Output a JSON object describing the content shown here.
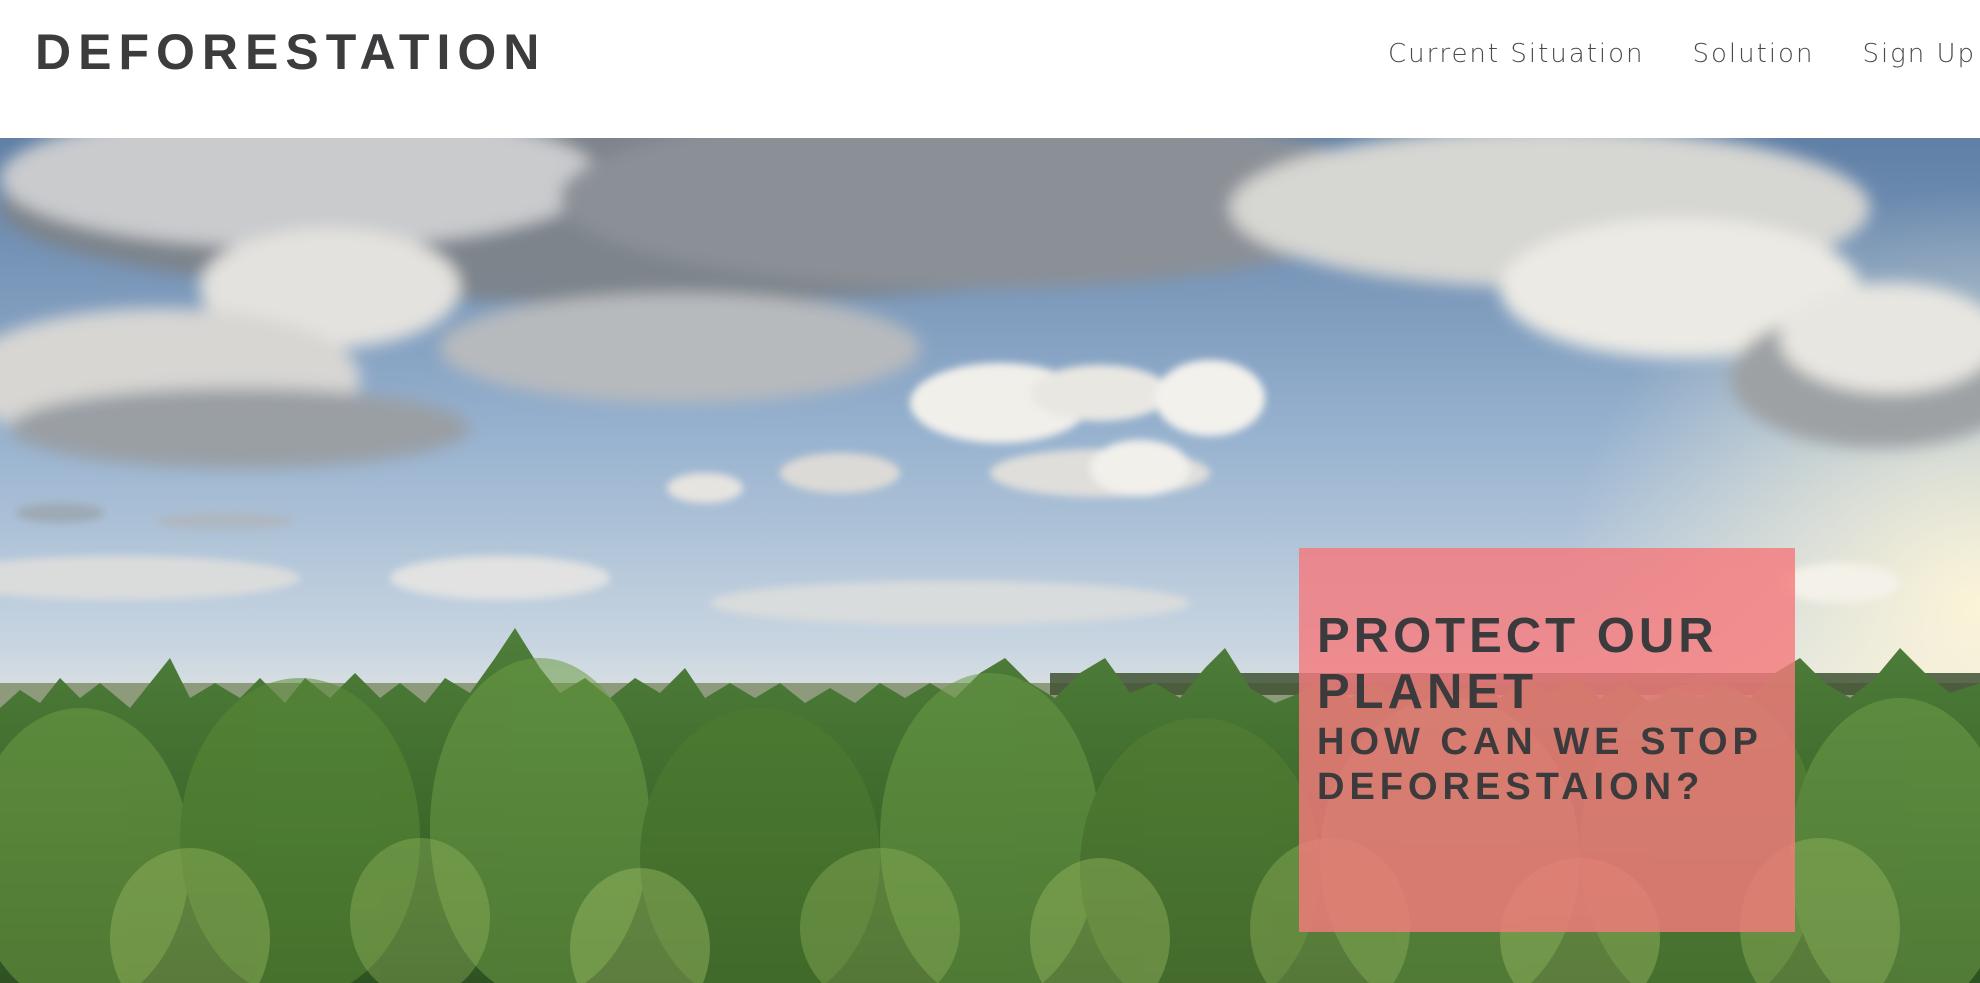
{
  "header": {
    "logo": "DEFORESTATION",
    "nav": [
      {
        "label": "Current Situation"
      },
      {
        "label": "Solution"
      },
      {
        "label": "Sign Up"
      }
    ]
  },
  "hero": {
    "title": "PROTECT OUR PLANET",
    "subtitle": "HOW CAN WE STOP DEFORESTAION?",
    "cta_color": "#F47A7C"
  }
}
